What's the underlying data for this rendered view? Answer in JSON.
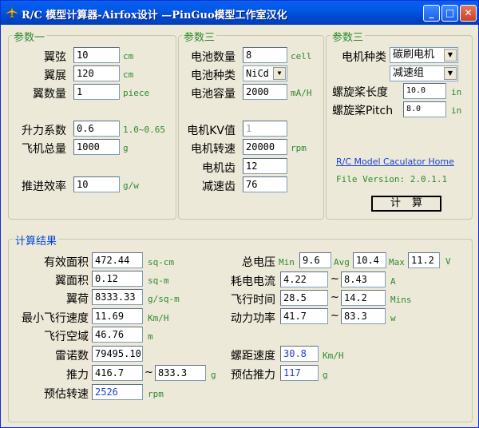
{
  "window": {
    "title": "R/C 模型计算器-Airfox设计 —PinGuo模型工作室汉化"
  },
  "groups": {
    "g1": "参数一",
    "g2": "参数三",
    "g3": "参数三",
    "results": "计算结果"
  },
  "wing": {
    "chord": {
      "label": "翼弦",
      "value": "10",
      "unit": "cm"
    },
    "span": {
      "label": "翼展",
      "value": "120",
      "unit": "cm"
    },
    "count": {
      "label": "翼数量",
      "value": "1",
      "unit": "piece"
    },
    "lift": {
      "label": "升力系数",
      "value": "0.6",
      "range": "1.0~0.65"
    },
    "weight": {
      "label": "飞机总量",
      "value": "1000",
      "unit": "g"
    },
    "thrust_eff": {
      "label": "推进效率",
      "value": "10",
      "unit": "g/w"
    }
  },
  "battery": {
    "cells": {
      "label": "电池数量",
      "value": "8",
      "unit": "cell"
    },
    "type": {
      "label": "电池种类",
      "value": "NiCd"
    },
    "capacity": {
      "label": "电池容量",
      "value": "2000",
      "unit": "mA/H"
    },
    "kv": {
      "label": "电机KV值",
      "value": "1"
    },
    "rpm": {
      "label": "电机转速",
      "value": "20000",
      "unit": "rpm"
    },
    "pinion": {
      "label": "电机齿",
      "value": "12"
    },
    "gear": {
      "label": "减速齿",
      "value": "76"
    }
  },
  "motor": {
    "type_label": "电机种类",
    "type_value": "碳刷电机",
    "gear_value": "减速组",
    "prop_len": {
      "label": "螺旋桨长度",
      "value": "10.0",
      "unit": "in"
    },
    "prop_pitch": {
      "label": "螺旋桨Pitch",
      "value": "8.0",
      "unit": "in"
    },
    "home_link": "R/C Model Caculator Home",
    "version": "File Version: 2.0.1.1",
    "calc_label": "计算"
  },
  "results": {
    "area": {
      "label": "有效面积",
      "value": "472.44",
      "unit": "sq-cm"
    },
    "wing_area": {
      "label": "翼面积",
      "value": "0.12",
      "unit": "sq-m"
    },
    "load": {
      "label": "翼荷",
      "value": "8333.33",
      "unit": "g/sq-m"
    },
    "min_speed": {
      "label": "最小飞行速度",
      "value": "11.69",
      "unit": "Km/H"
    },
    "airspace": {
      "label": "飞行空域",
      "value": "46.76",
      "unit": "m"
    },
    "reynolds": {
      "label": "雷诺数",
      "value": "79495.10"
    },
    "thrust": {
      "label": "推力",
      "min": "416.7",
      "max": "833.3",
      "unit": "g"
    },
    "est_rpm": {
      "label": "预估转速",
      "value": "2526",
      "unit": "rpm"
    },
    "voltage": {
      "label": "总电压",
      "min_label": "Min",
      "min": "9.6",
      "avg_label": "Avg",
      "avg": "10.4",
      "max_label": "Max",
      "max": "11.2",
      "unit": "V"
    },
    "current": {
      "label": "耗电电流",
      "min": "4.22",
      "max": "8.43",
      "unit": "A"
    },
    "flight_time": {
      "label": "飞行时间",
      "min": "28.5",
      "max": "14.2",
      "unit": "Mins"
    },
    "power": {
      "label": "动力功率",
      "min": "41.7",
      "max": "83.3",
      "unit": "w"
    },
    "pitch_speed": {
      "label": "螺距速度",
      "value": "30.8",
      "unit": "Km/H"
    },
    "est_thrust": {
      "label": "预估推力",
      "value": "117",
      "unit": "g"
    }
  },
  "tilde": "~"
}
